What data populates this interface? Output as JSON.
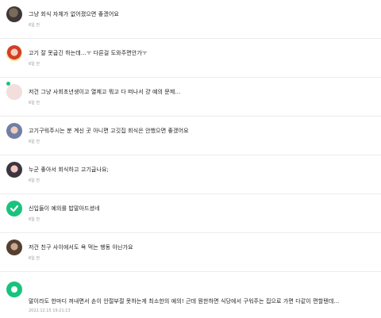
{
  "comments": [
    {
      "text": "그냥 회식 자체가 없어졌으면 좋겠어요",
      "time": "6일 전"
    },
    {
      "text": "고기 잘 못굽긴 하는데...ㅜ 다른걸 도와주면안가ㅜ",
      "time": "6일 전"
    },
    {
      "text": "저건 그냥 사회초년생이고 열제고 뭐고 다 떠나서 걍 예의 문제...",
      "time": "6일 전"
    },
    {
      "text": "고기구워주시는 분 계신 곳 아니면 고깃집 회식은 안했으면 좋겠어요",
      "time": "6일 전"
    },
    {
      "text": "누군 좋아서 회식하고 고기굽나요;",
      "time": "6일 전"
    },
    {
      "text": "신입들이 예의를 밥말아드셨네",
      "time": "6일 전"
    },
    {
      "text": "저건 친구 사이에서도 욕 먹는 행동 아닌가요",
      "time": "6일 전"
    },
    {
      "text": "말이라도 한마디 꺼내면서 손이 안절부절 못하는게 최소한의 예의! 근데 뭔한하면 식당에서 구워주는 집으로 가면 다같이 편할텐데...",
      "time": "2022.12.15 19:21:13"
    }
  ]
}
